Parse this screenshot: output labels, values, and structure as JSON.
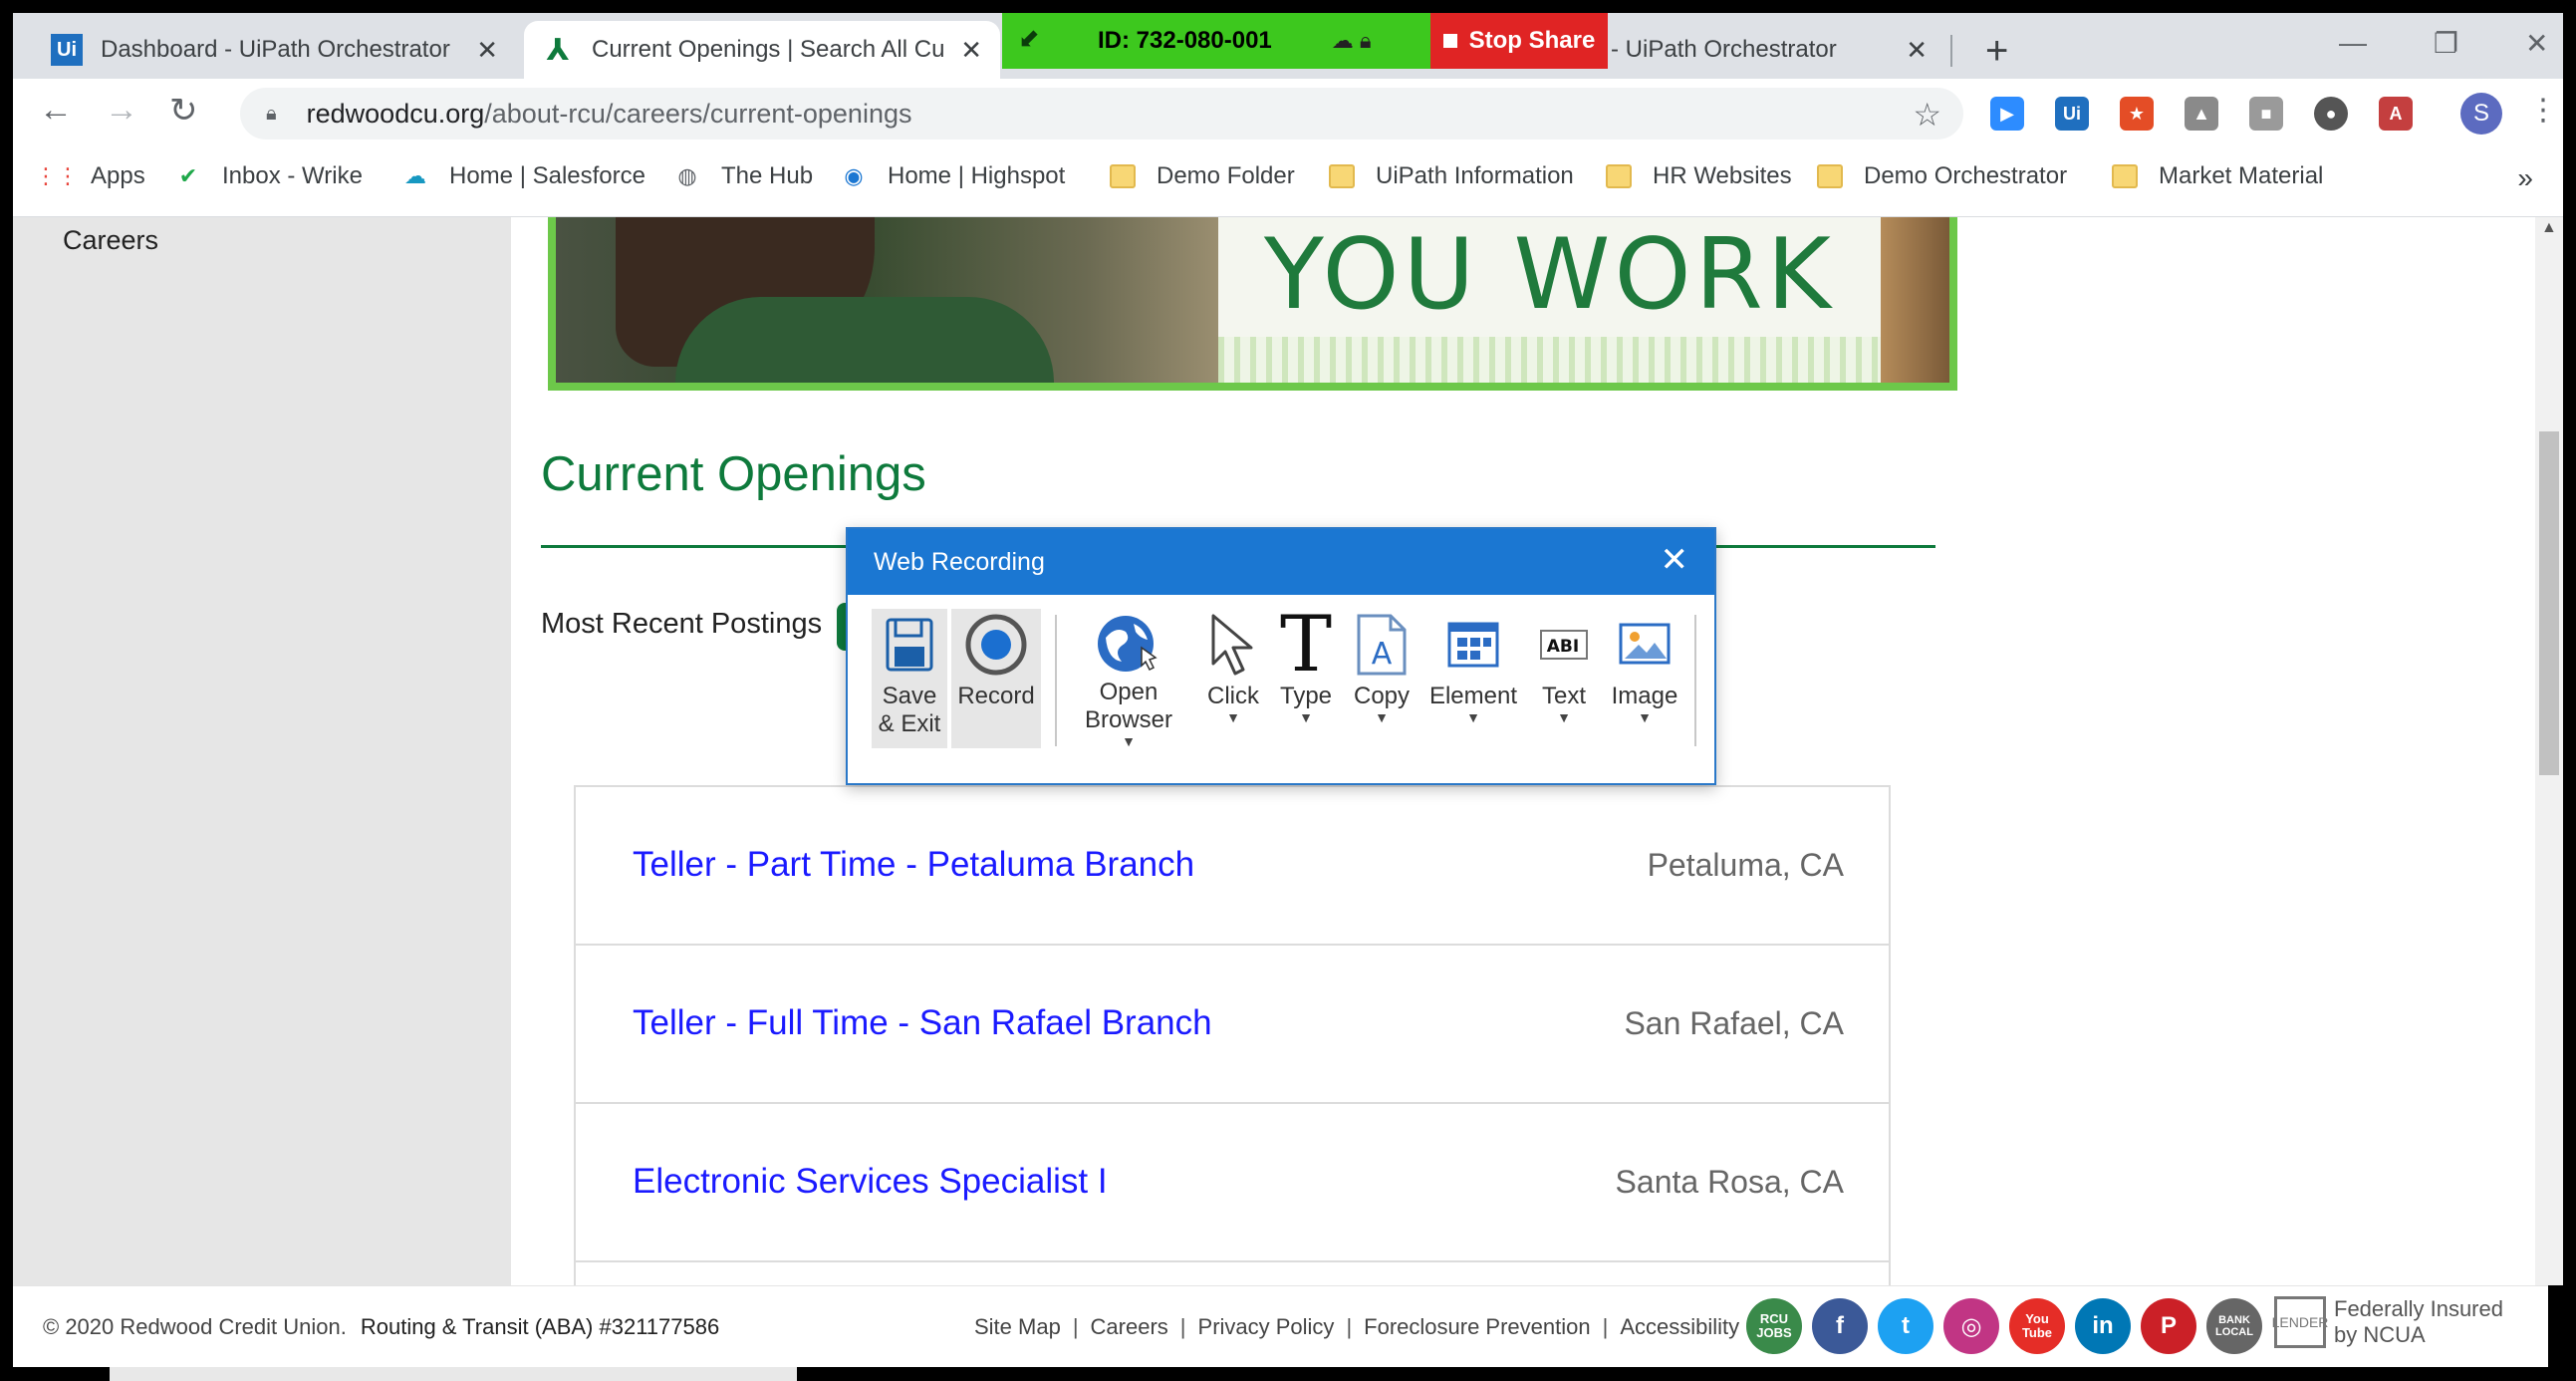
{
  "browser": {
    "tabs": [
      {
        "title": "Dashboard - UiPath Orchestrator",
        "favicon": "uipath-icon",
        "close": "✕"
      },
      {
        "title": "Current Openings | Search All Cu",
        "favicon": "redwood-tree-icon",
        "close": "✕"
      },
      {
        "title": "sses - UiPath Orchestrator",
        "favicon": "uipath-icon",
        "close": "✕"
      }
    ],
    "new_tab": "+",
    "window_controls": {
      "minimize": "—",
      "restore": "❐",
      "close": "✕"
    },
    "share": {
      "id_label": "ID: 732-080-001",
      "stop_label": "Stop Share"
    },
    "url_domain": "redwoodcu.org",
    "url_path": "/about-rcu/careers/current-openings",
    "avatar_initial": "S",
    "bookmarks": [
      {
        "label": "Apps",
        "icon": "apps-grid-icon"
      },
      {
        "label": "Inbox - Wrike",
        "icon": "wrike-check-icon"
      },
      {
        "label": "Home | Salesforce",
        "icon": "salesforce-cloud-icon"
      },
      {
        "label": "The Hub",
        "icon": "globe-icon"
      },
      {
        "label": "Home | Highspot",
        "icon": "highspot-icon"
      },
      {
        "label": "Demo Folder",
        "icon": "folder-icon"
      },
      {
        "label": "UiPath Information",
        "icon": "folder-icon"
      },
      {
        "label": "HR Websites",
        "icon": "folder-icon"
      },
      {
        "label": "Demo Orchestrator",
        "icon": "folder-icon"
      },
      {
        "label": "Market Material",
        "icon": "folder-icon"
      }
    ],
    "bookmarks_more": "»"
  },
  "page": {
    "sidebar_label": "Careers",
    "banner_text": "YOU WORK",
    "heading": "Current Openings",
    "recent_label": "Most Recent Postings",
    "jobs": [
      {
        "title": "Teller - Part Time - Petaluma Branch",
        "location": "Petaluma, CA"
      },
      {
        "title": "Teller - Full Time - San Rafael Branch",
        "location": "San Rafael, CA"
      },
      {
        "title": "Electronic Services Specialist I",
        "location": "Santa Rosa, CA"
      }
    ],
    "footer": {
      "copyright": "© 2020 Redwood Credit Union.",
      "routing": "Routing & Transit (ABA) #321177586",
      "links": [
        "Site Map",
        "Careers",
        "Privacy Policy",
        "Foreclosure Prevention",
        "Accessibility"
      ],
      "social": [
        {
          "name": "rcu-jobs-icon",
          "glyph": "RCU JOBS",
          "color": "#3a8a4a"
        },
        {
          "name": "facebook-icon",
          "glyph": "f",
          "color": "#3b5998"
        },
        {
          "name": "twitter-icon",
          "glyph": "t",
          "color": "#1da1f2"
        },
        {
          "name": "instagram-icon",
          "glyph": "◎",
          "color": "#c13584"
        },
        {
          "name": "youtube-icon",
          "glyph": "You Tube",
          "color": "#e52d27"
        },
        {
          "name": "linkedin-icon",
          "glyph": "in",
          "color": "#0077b5"
        },
        {
          "name": "pinterest-icon",
          "glyph": "P",
          "color": "#cb2027"
        },
        {
          "name": "bank-local-icon",
          "glyph": "BANK LOCAL",
          "color": "#666666"
        }
      ],
      "ncua_text": "Federally Insured by NCUA",
      "lender_label": "LENDER"
    }
  },
  "web_recording": {
    "title": "Web Recording",
    "close": "✕",
    "tools": [
      {
        "label": "Save & Exit",
        "icon": "save-icon"
      },
      {
        "label": "Record",
        "icon": "record-icon"
      },
      {
        "label": "Open Browser",
        "icon": "open-browser-globe-icon"
      },
      {
        "label": "Click",
        "icon": "cursor-icon"
      },
      {
        "label": "Type",
        "icon": "type-t-icon"
      },
      {
        "label": "Copy",
        "icon": "copy-doc-icon"
      },
      {
        "label": "Element",
        "icon": "element-grid-icon"
      },
      {
        "label": "Text",
        "icon": "text-abi-icon"
      },
      {
        "label": "Image",
        "icon": "image-icon"
      }
    ]
  },
  "colors": {
    "accent_green": "#0e7a3c",
    "link_blue": "#1a1aff",
    "dialog_blue": "#1b77d2",
    "share_green": "#3dc81e",
    "stop_red": "#e02424"
  }
}
